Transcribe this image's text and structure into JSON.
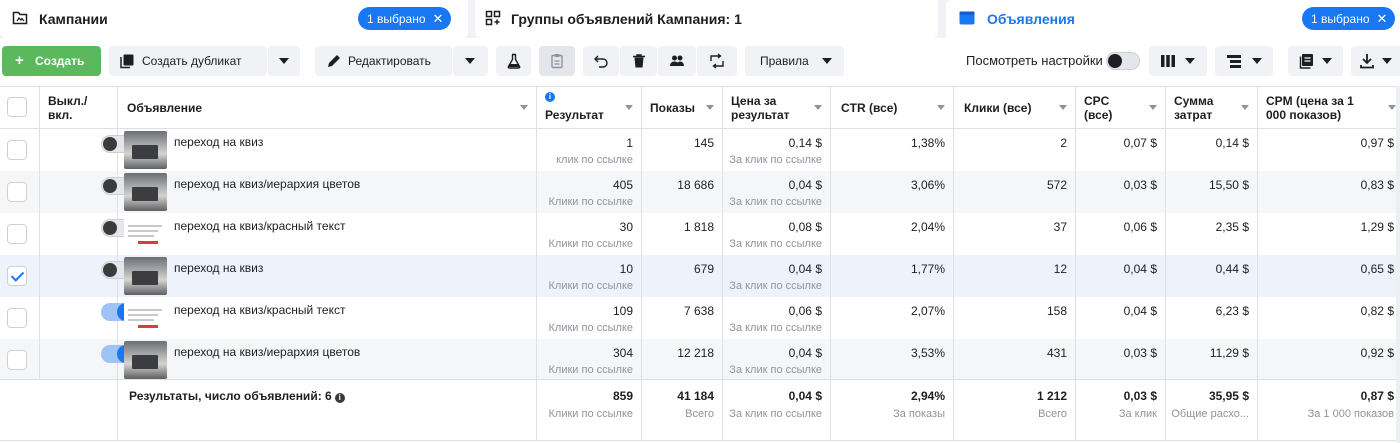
{
  "tabs": [
    {
      "title": "Кампании",
      "badge": "1 выбрано",
      "icon": "folder-icon"
    },
    {
      "title": "Группы объявлений Кампания: 1",
      "icon": "grid-icon"
    },
    {
      "title": "Объявления",
      "badge": "1 выбрано",
      "icon": "ad-icon"
    }
  ],
  "toolbar": {
    "create": "Создать",
    "duplicate": "Создать дубликат",
    "edit": "Редактировать",
    "rules": "Правила",
    "view_settings": "Посмотреть настройки"
  },
  "colors": {
    "accent": "#1877f2",
    "create": "#5cb85c"
  },
  "columns": [
    {
      "key": "toggle",
      "label": "Выкл./\nвкл."
    },
    {
      "key": "ad",
      "label": "Объявление"
    },
    {
      "key": "result",
      "label": "Результат"
    },
    {
      "key": "impressions",
      "label": "Показы"
    },
    {
      "key": "cpr",
      "label": "Цена за\nрезультат"
    },
    {
      "key": "ctr",
      "label": "CTR (все)"
    },
    {
      "key": "clicks",
      "label": "Клики (все)"
    },
    {
      "key": "cpc",
      "label": "CPC\n(все)"
    },
    {
      "key": "spend",
      "label": "Сумма\nзатрат"
    },
    {
      "key": "cpm",
      "label": "CPM (цена за 1\n000 показов)"
    }
  ],
  "rows": [
    {
      "checked": false,
      "on": false,
      "thumb": "photo",
      "name": "переход на квиз",
      "result": "1",
      "result_sub": "клик по ссылке",
      "impressions": "145",
      "cpr": "0,14 $",
      "cpr_sub": "За клик по ссылке",
      "ctr": "1,38%",
      "clicks": "2",
      "cpc": "0,07 $",
      "spend": "0,14 $",
      "cpm": "0,97 $"
    },
    {
      "checked": false,
      "on": false,
      "thumb": "photo",
      "name": "переход на квиз/иерархия цветов",
      "result": "405",
      "result_sub": "Клики по ссылке",
      "impressions": "18 686",
      "cpr": "0,04 $",
      "cpr_sub": "За клик по ссылке",
      "ctr": "3,06%",
      "clicks": "572",
      "cpc": "0,03 $",
      "spend": "15,50 $",
      "cpm": "0,83 $"
    },
    {
      "checked": false,
      "on": false,
      "thumb": "text",
      "name": "переход на квиз/красный текст",
      "result": "30",
      "result_sub": "Клики по ссылке",
      "impressions": "1 818",
      "cpr": "0,08 $",
      "cpr_sub": "За клик по ссылке",
      "ctr": "2,04%",
      "clicks": "37",
      "cpc": "0,06 $",
      "spend": "2,35 $",
      "cpm": "1,29 $"
    },
    {
      "checked": true,
      "on": false,
      "thumb": "photo",
      "name": "переход на квиз",
      "result": "10",
      "result_sub": "Клики по ссылке",
      "impressions": "679",
      "cpr": "0,04 $",
      "cpr_sub": "За клик по ссылке",
      "ctr": "1,77%",
      "clicks": "12",
      "cpc": "0,04 $",
      "spend": "0,44 $",
      "cpm": "0,65 $"
    },
    {
      "checked": false,
      "on": true,
      "thumb": "text",
      "name": "переход на квиз/красный текст",
      "result": "109",
      "result_sub": "Клики по ссылке",
      "impressions": "7 638",
      "cpr": "0,06 $",
      "cpr_sub": "За клик по ссылке",
      "ctr": "2,07%",
      "clicks": "158",
      "cpc": "0,04 $",
      "spend": "6,23 $",
      "cpm": "0,82 $"
    },
    {
      "checked": false,
      "on": true,
      "thumb": "photo",
      "name": "переход на квиз/иерархия цветов",
      "result": "304",
      "result_sub": "Клики по ссылке",
      "impressions": "12 218",
      "cpr": "0,04 $",
      "cpr_sub": "За клик по ссылке",
      "ctr": "3,53%",
      "clicks": "431",
      "cpc": "0,03 $",
      "spend": "11,29 $",
      "cpm": "0,92 $"
    }
  ],
  "totals": {
    "title": "Результаты, число объявлений: 6",
    "result": "859",
    "result_sub": "Клики по ссылке",
    "impressions": "41 184",
    "impressions_sub": "Всего",
    "cpr": "0,04 $",
    "cpr_sub": "За клик по ссылке",
    "ctr": "2,94%",
    "ctr_sub": "За показы",
    "clicks": "1 212",
    "clicks_sub": "Всего",
    "cpc": "0,03 $",
    "cpc_sub": "За клик",
    "spend": "35,95 $",
    "spend_sub": "Общие расхо...",
    "cpm": "0,87 $",
    "cpm_sub": "За 1 000 показов"
  }
}
